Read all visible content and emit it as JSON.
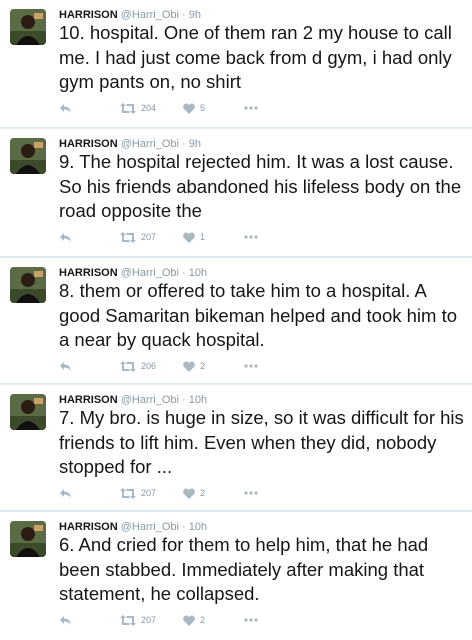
{
  "tweets": [
    {
      "name": "HARRISON",
      "handle": "@Harri_Obi",
      "separator": "·",
      "time": "9h",
      "text": "10. hospital. One of them ran 2 my house to call me. I had just come back from d gym, i had only gym pants on, no shirt",
      "retweets": "204",
      "likes": "5"
    },
    {
      "name": "HARRISON",
      "handle": "@Harri_Obi",
      "separator": "·",
      "time": "9h",
      "text": "9. The hospital rejected him. It was a lost cause. So his friends abandoned his lifeless body on the road opposite the",
      "retweets": "207",
      "likes": "1"
    },
    {
      "name": "HARRISON",
      "handle": "@Harri_Obi",
      "separator": "·",
      "time": "10h",
      "text": "8. them or offered to take him to a hospital. A good Samaritan bikeman helped and took him to a near by quack hospital.",
      "retweets": "206",
      "likes": "2"
    },
    {
      "name": "HARRISON",
      "handle": "@Harri_Obi",
      "separator": "·",
      "time": "10h",
      "text": "7. My bro. is huge in size, so it was difficult for his friends to lift him. Even when they did, nobody stopped for ...",
      "retweets": "207",
      "likes": "2"
    },
    {
      "name": "HARRISON",
      "handle": "@Harri_Obi",
      "separator": "·",
      "time": "10h",
      "text": "6. And cried for them to help him, that he had been stabbed. Immediately after making that statement, he collapsed.",
      "retweets": "207",
      "likes": "2"
    }
  ],
  "icons": {
    "reply": "reply-icon",
    "retweet": "retweet-icon",
    "like": "heart-icon",
    "more": "more-icon"
  },
  "colors": {
    "action_icon": "#aab8c2",
    "meta_text": "#8899a6",
    "divider": "#e6ecf0"
  }
}
